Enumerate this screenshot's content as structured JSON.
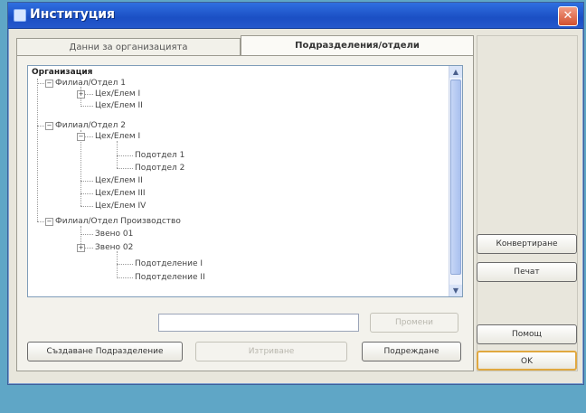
{
  "window": {
    "title": "Институция"
  },
  "tabs": [
    {
      "label": "Данни за организацията"
    },
    {
      "label": "Подразделения/отдели"
    }
  ],
  "tree": {
    "root": "Организация",
    "items": [
      {
        "label": "Филиал/Отдел 1"
      },
      {
        "label": "Цех/Елем I"
      },
      {
        "label": "Цех/Елем II"
      },
      {
        "label": "Филиал/Отдел 2"
      },
      {
        "label": "Цех/Елем I"
      },
      {
        "label": "Подотдел 1"
      },
      {
        "label": "Подотдел 2"
      },
      {
        "label": "Цех/Елем II"
      },
      {
        "label": "Цех/Елем III"
      },
      {
        "label": "Цех/Елем IV"
      },
      {
        "label": "Филиал/Отдел Производство"
      },
      {
        "label": "Звено 01"
      },
      {
        "label": "Звено 02"
      },
      {
        "label": "Подотделение I"
      },
      {
        "label": "Подотделение II"
      }
    ]
  },
  "form": {
    "name_value": "",
    "rename_label": "Промени",
    "create_label": "Създаване Подразделение",
    "edit_label": "Изтриване",
    "sort_label": "Подреждане"
  },
  "side": {
    "convert_label": "Конвертиране",
    "print_label": "Печат",
    "help_label": "Помощ",
    "ok_label": "OK"
  }
}
